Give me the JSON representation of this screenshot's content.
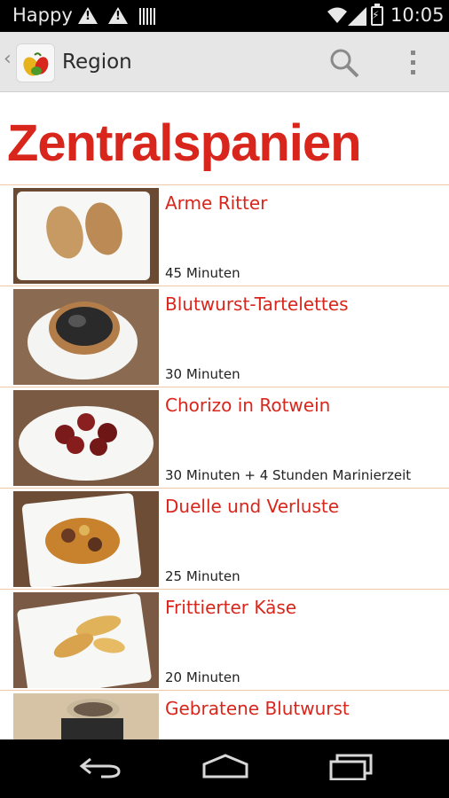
{
  "status_bar": {
    "carrier": "Happy",
    "time": "10:05",
    "icons": [
      "warning-icon",
      "warning-icon",
      "barcode-icon",
      "wifi-icon",
      "signal-icon",
      "battery-charging-icon"
    ]
  },
  "action_bar": {
    "title": "Region",
    "icons": [
      "up-caret-icon",
      "app-icon",
      "search-icon",
      "overflow-menu-icon"
    ]
  },
  "page": {
    "heading": "Zentralspanien"
  },
  "recipes": [
    {
      "name": "Arme Ritter",
      "time": "45 Minuten"
    },
    {
      "name": "Blutwurst-Tartelettes",
      "time": "30 Minuten"
    },
    {
      "name": "Chorizo in Rotwein",
      "time": "30 Minuten + 4 Stunden Marinierzeit"
    },
    {
      "name": "Duelle und Verluste",
      "time": "25 Minuten"
    },
    {
      "name": "Frittierter Käse",
      "time": "20 Minuten"
    },
    {
      "name": "Gebratene Blutwurst",
      "time": ""
    }
  ],
  "nav_bar": {
    "icons": [
      "back-icon",
      "home-icon",
      "recents-icon"
    ]
  },
  "colors": {
    "accent": "#d9261c",
    "divider": "#f0c9a8",
    "action_bar": "#e6e6e6"
  }
}
